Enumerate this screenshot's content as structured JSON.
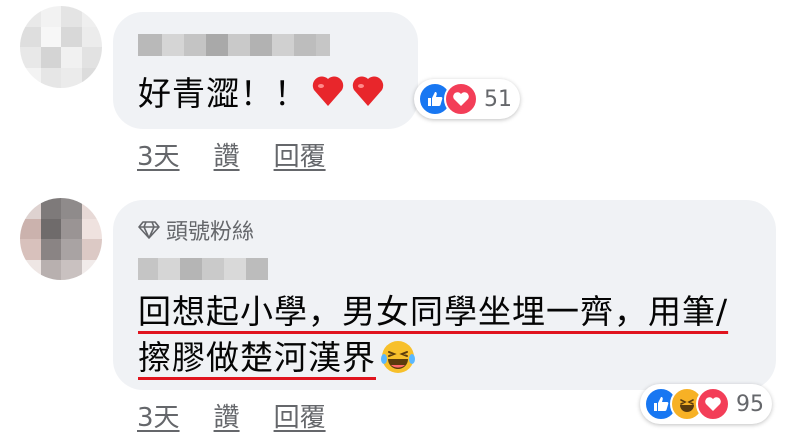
{
  "comments": [
    {
      "text": "好青澀！！",
      "reaction_count": "51",
      "actions": {
        "time": "3天",
        "like": "讚",
        "reply": "回覆"
      }
    },
    {
      "badge": "頭號粉絲",
      "line1": "回想起小學，男女同學坐埋一齊，用筆/",
      "line2": "擦膠做楚河漢界",
      "reaction_count": "95",
      "actions": {
        "time": "3天",
        "like": "讚",
        "reply": "回覆"
      }
    }
  ],
  "colors": {
    "bubble": "#f0f2f5",
    "like_blue": "#1877f2",
    "love_red": "#f33e58",
    "haha_yellow": "#f7b125",
    "underline_red": "#e0141e",
    "meta_gray": "#65676b"
  },
  "icons": [
    "avatar",
    "heart-emoji",
    "diamond-badge-icon",
    "like-reaction-icon",
    "love-reaction-icon",
    "haha-reaction-icon",
    "laugh-cry-emoji"
  ]
}
